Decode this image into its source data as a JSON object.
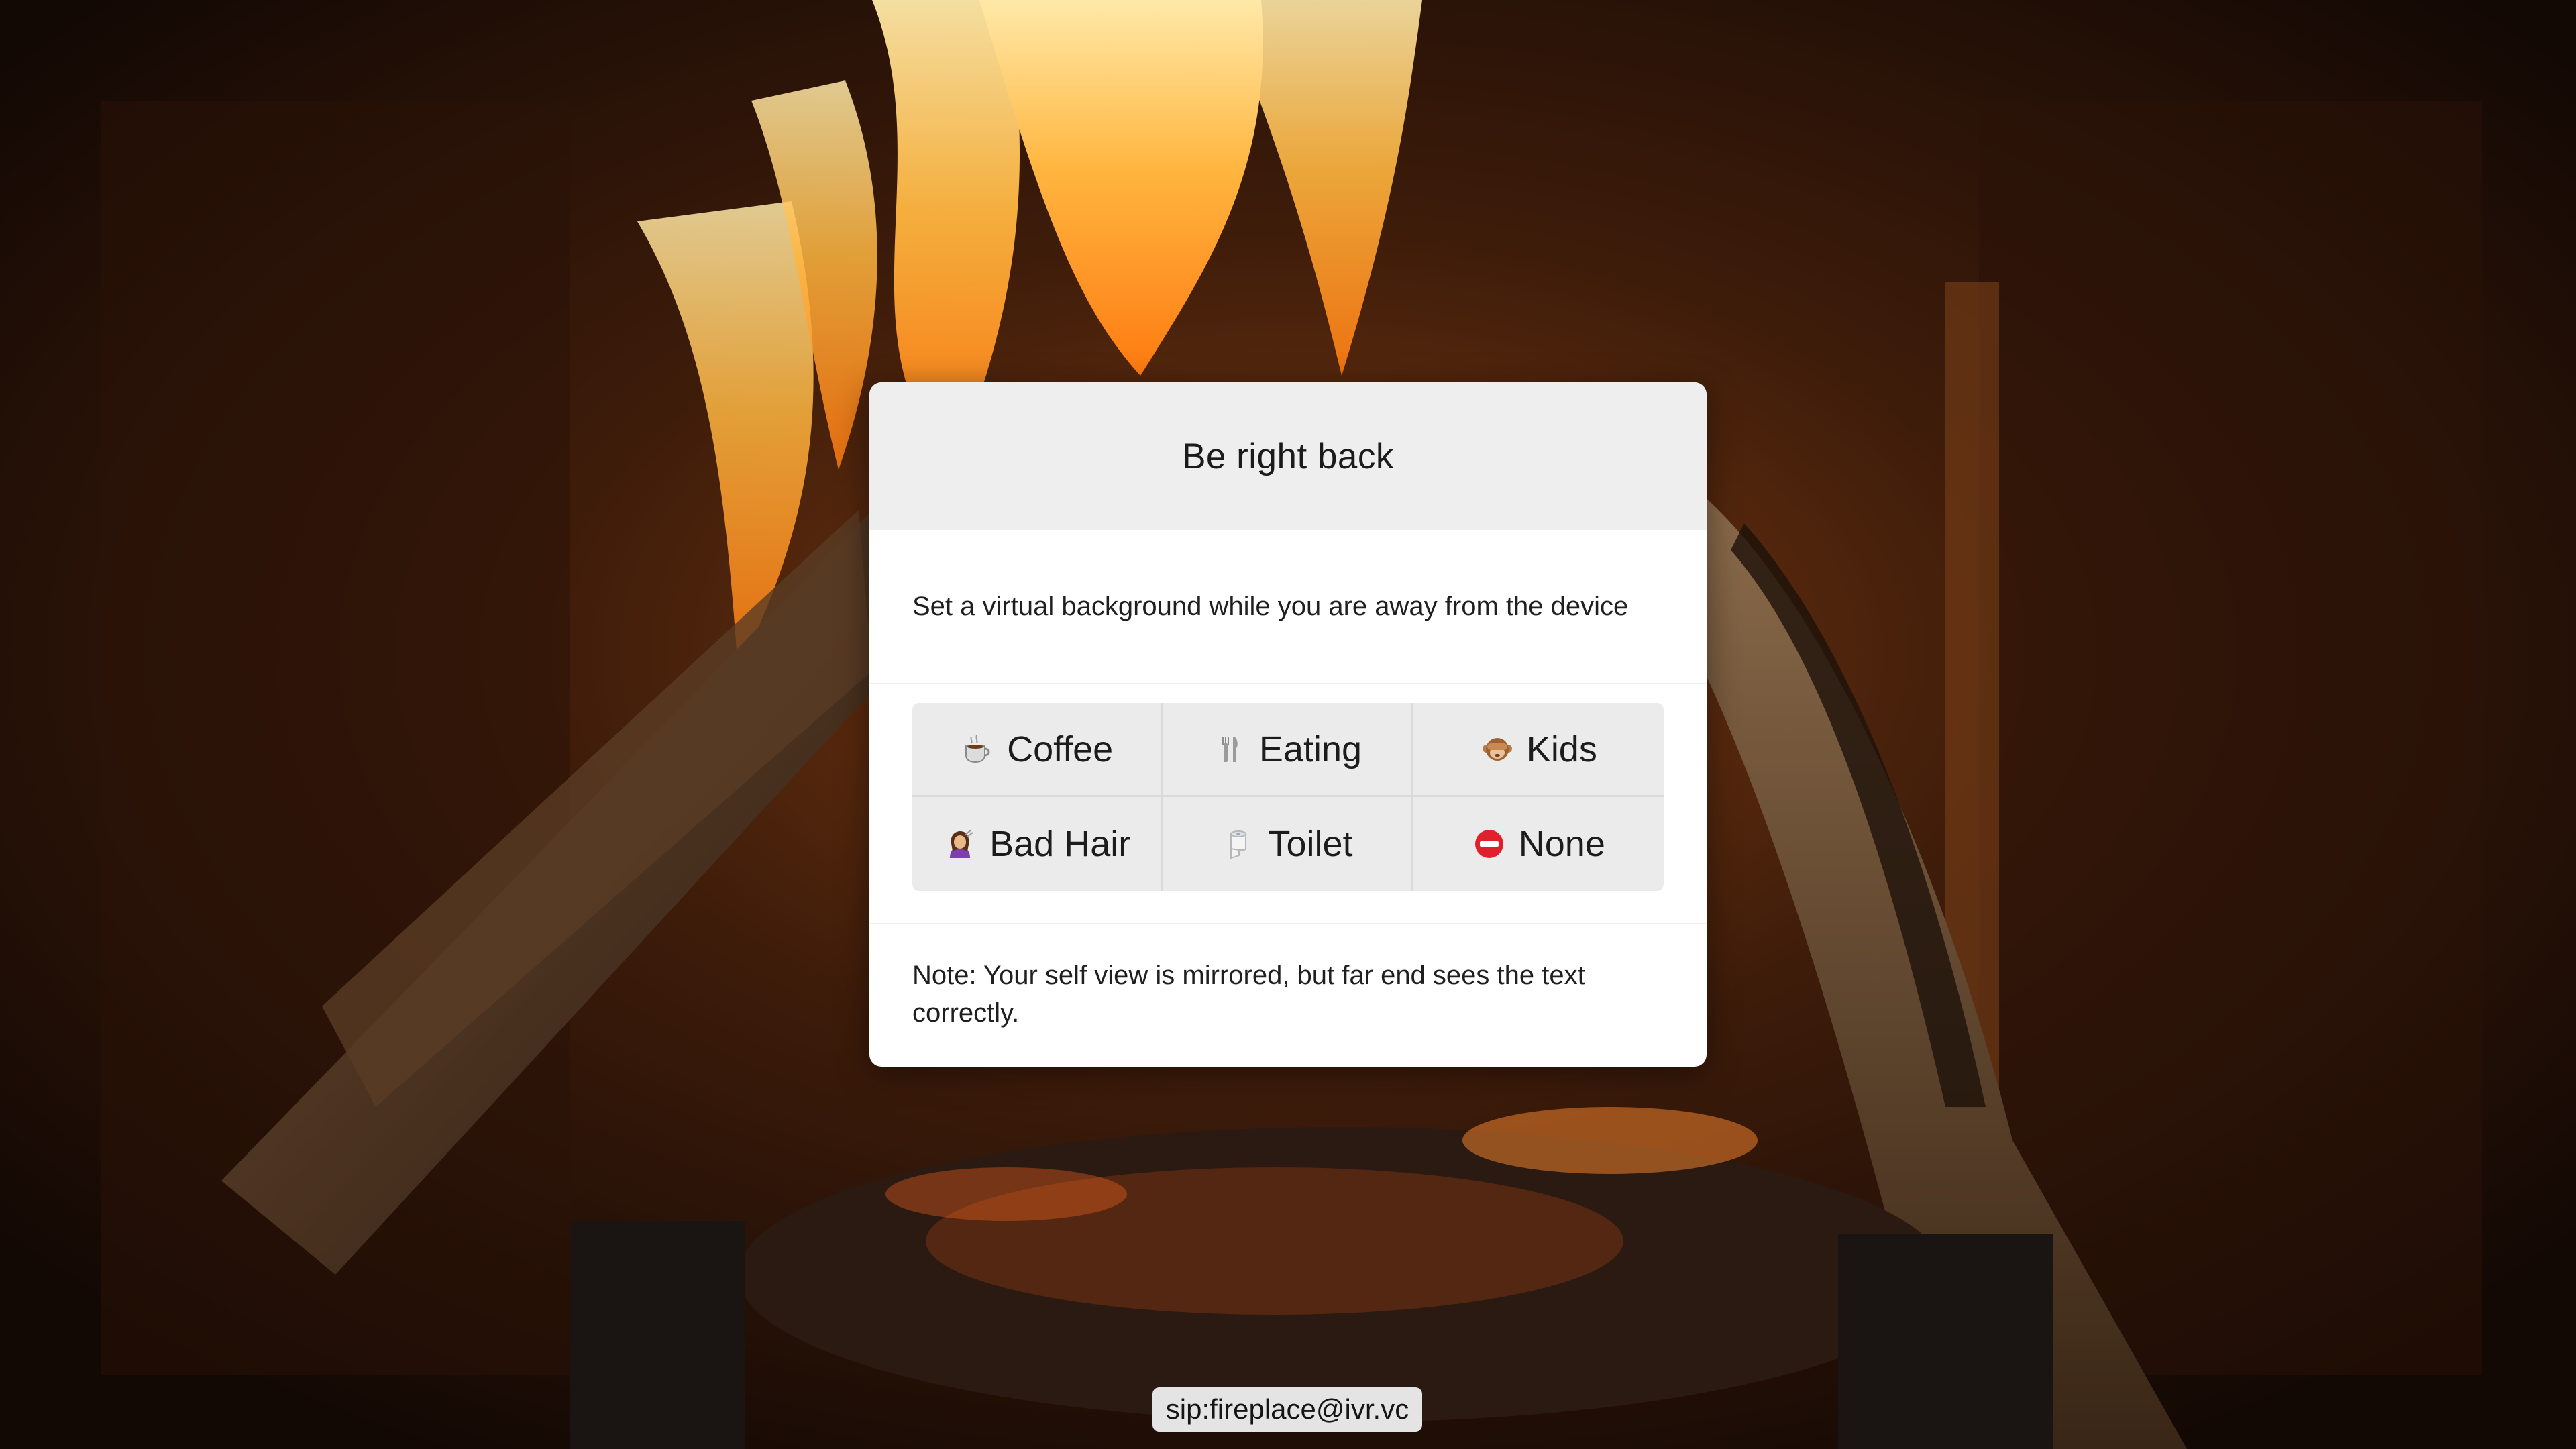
{
  "dialog": {
    "title": "Be right back",
    "description": "Set a virtual background while you are away from the device",
    "options": [
      {
        "label": "Coffee",
        "icon": "coffee-icon"
      },
      {
        "label": "Eating",
        "icon": "fork-knife-icon"
      },
      {
        "label": "Kids",
        "icon": "monkey-icon"
      },
      {
        "label": "Bad Hair",
        "icon": "hairdresser-icon"
      },
      {
        "label": "Toilet",
        "icon": "toilet-paper-icon"
      },
      {
        "label": "None",
        "icon": "no-entry-icon"
      }
    ],
    "note": "Note: Your self view is mirrored, but far end sees the text correctly."
  },
  "footer": {
    "sip_address": "sip:fireplace@ivr.vc"
  },
  "colors": {
    "header_bg": "#eeeeee",
    "option_bg": "#ebebeb",
    "badge_bg": "#e4e4e4"
  }
}
